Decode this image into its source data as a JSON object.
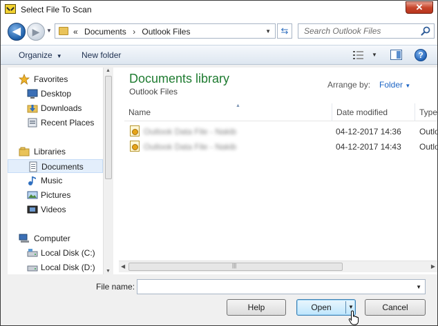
{
  "window": {
    "title": "Select File To Scan",
    "close_label": "✕"
  },
  "address": {
    "back_label": "◀",
    "forward_label": "▶",
    "crumb_prefix": "«",
    "crumbs": [
      "Documents",
      "Outlook Files"
    ],
    "crumb_separator": "›",
    "refresh_label": "⇆"
  },
  "search": {
    "placeholder": "Search Outlook Files"
  },
  "toolbar": {
    "organize_label": "Organize",
    "new_folder_label": "New folder",
    "help_label": "?"
  },
  "nav": {
    "favorites": {
      "label": "Favorites",
      "items": [
        {
          "label": "Desktop"
        },
        {
          "label": "Downloads"
        },
        {
          "label": "Recent Places"
        }
      ]
    },
    "libraries": {
      "label": "Libraries",
      "items": [
        {
          "label": "Documents",
          "selected": true
        },
        {
          "label": "Music"
        },
        {
          "label": "Pictures"
        },
        {
          "label": "Videos"
        }
      ]
    },
    "computer": {
      "label": "Computer",
      "items": [
        {
          "label": "Local Disk (C:)"
        },
        {
          "label": "Local Disk (D:)"
        }
      ]
    }
  },
  "content": {
    "library_title": "Documents library",
    "library_subtitle": "Outlook Files",
    "arrange_by_label": "Arrange by:",
    "arrange_by_value": "Folder",
    "columns": {
      "name": "Name",
      "date_modified": "Date modified",
      "type": "Type"
    },
    "files": [
      {
        "name": "Outlook Data File - Nakib",
        "date_modified": "04-12-2017 14:36",
        "type": "Outlo"
      },
      {
        "name": "Outlook Data File - Nakib",
        "date_modified": "04-12-2017 14:43",
        "type": "Outlo"
      }
    ]
  },
  "footer": {
    "file_name_label": "File name:",
    "file_name_value": "",
    "help_button": "Help",
    "open_button": "Open",
    "cancel_button": "Cancel"
  },
  "colors": {
    "library_title": "#1e7b30",
    "link": "#1b64c4",
    "open_button_border": "#3c7fb1"
  }
}
